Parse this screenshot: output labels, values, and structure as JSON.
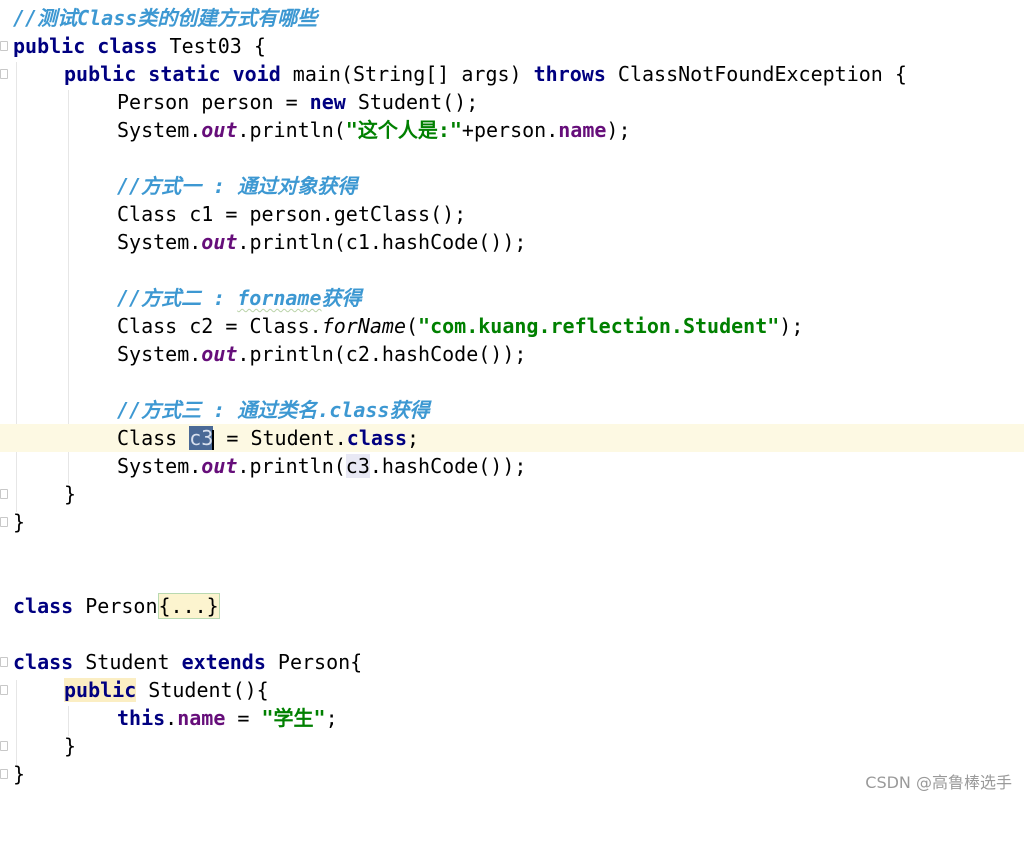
{
  "editor": {
    "comment_header": "//测试Class类的创建方式有哪些",
    "class_decl": {
      "kw": "public class",
      "name": " Test03 {"
    },
    "main_decl": {
      "kw1": "public static void",
      "sig": " main(String[] args) ",
      "kw2": "throws",
      "rest": " ClassNotFoundException {"
    },
    "line_person": {
      "a": "Person person = ",
      "kw": "new",
      "b": " Student();"
    },
    "line_print_name": {
      "a": "System.",
      "out": "out",
      "b": ".println(",
      "str": "\"这个人是:\"",
      "c": "+person.",
      "field": "name",
      "d": ");"
    },
    "comment_way1": "//方式一 : 通过对象获得",
    "line_c1": "Class c1 = person.getClass();",
    "line_print_c1": {
      "a": "System.",
      "out": "out",
      "b": ".println(c1.hashCode());"
    },
    "comment_way2_a": "//方式二 : ",
    "comment_way2_b": "forname",
    "comment_way2_c": "获得",
    "line_c2": {
      "a": "Class c2 = Class.",
      "method": "forName",
      "b": "(",
      "str": "\"com.kuang.reflection.Student\"",
      "c": ");"
    },
    "line_print_c2": {
      "a": "System.",
      "out": "out",
      "b": ".println(c2.hashCode());"
    },
    "comment_way3": "//方式三 : 通过类名.class获得",
    "line_c3": {
      "a": "Class ",
      "var": "c3",
      "b": " = Student.",
      "kw": "class",
      "c": ";"
    },
    "line_print_c3": {
      "a": "System.",
      "out": "out",
      "b": ".println(",
      "var": "c3",
      "c": ".hashCode());"
    },
    "close_method": "}",
    "close_class": "}",
    "person_class": {
      "kw": "class",
      "name": " Person",
      "folded": "{...}"
    },
    "student_class": {
      "kw1": "class",
      "name": " Student ",
      "kw2": "extends",
      "rest": " Person{"
    },
    "student_ctor": {
      "kw": "public",
      "rest": " Student(){"
    },
    "student_body": {
      "kw": "this",
      "dot": ".",
      "field": "name",
      "eq": " = ",
      "str": "\"学生\"",
      "end": ";"
    },
    "close_ctor": "}",
    "close_student": "}"
  },
  "watermark": "CSDN @高鲁棒选手",
  "colors": {
    "keyword": "#000080",
    "comment": "#3d98d2",
    "string": "#008000",
    "field": "#660e7a",
    "current_line": "#fdf9e3",
    "selection": "#4a6996"
  }
}
